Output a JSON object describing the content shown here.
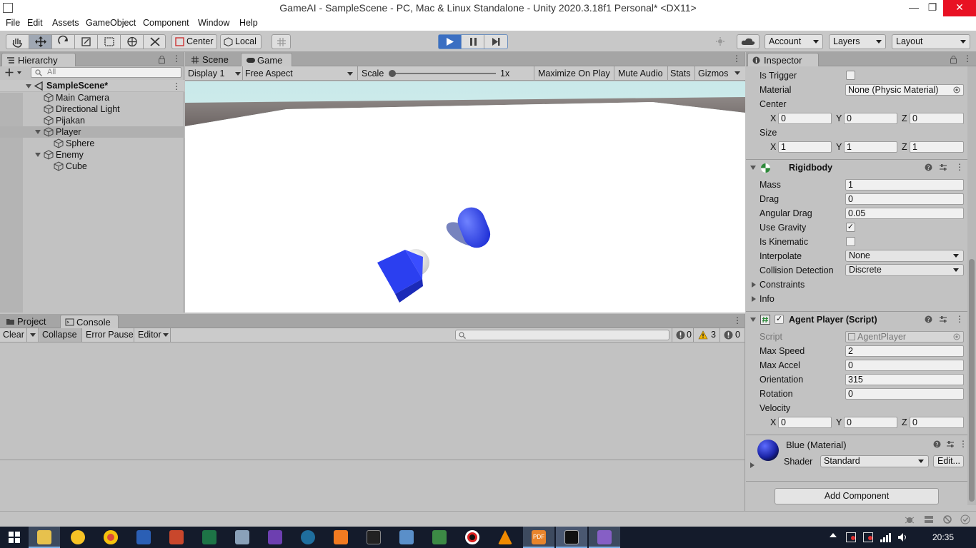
{
  "window": {
    "title": "GameAI - SampleScene - PC, Mac & Linux Standalone - Unity 2020.3.18f1 Personal* <DX11>",
    "minimize": "—",
    "restore": "❐",
    "close": "✕"
  },
  "menu": [
    "File",
    "Edit",
    "Assets",
    "GameObject",
    "Component",
    "Window",
    "Help"
  ],
  "toolbar": {
    "pivot_label": "Center",
    "space_label": "Local",
    "account_label": "Account",
    "layers_label": "Layers",
    "layout_label": "Layout",
    "play_color": "#3b6fc2"
  },
  "hierarchy": {
    "tab": "Hierarchy",
    "search_placeholder": "All",
    "scene": "SampleScene*",
    "items": [
      {
        "label": "Main Camera"
      },
      {
        "label": "Directional Light"
      },
      {
        "label": "Pijakan"
      },
      {
        "label": "Player"
      },
      {
        "label": "Sphere"
      },
      {
        "label": "Enemy"
      },
      {
        "label": "Cube"
      }
    ]
  },
  "game": {
    "tabs": [
      "Scene",
      "Game"
    ],
    "display": "Display 1",
    "aspect": "Free Aspect",
    "scale_label": "Scale",
    "scale_value": "1x",
    "scale_fraction": 0.0,
    "buttons": [
      "Maximize On Play",
      "Mute Audio",
      "Stats",
      "Gizmos"
    ],
    "object_color": "#2b3ff0"
  },
  "console": {
    "tabs": [
      "Project",
      "Console"
    ],
    "clear": "Clear",
    "collapse": "Collapse",
    "error_pause": "Error Pause",
    "editor": "Editor",
    "log_count": "0",
    "warning_count": "3",
    "error_count": "0"
  },
  "inspector": {
    "tab": "Inspector",
    "collider": {
      "is_trigger_label": "Is Trigger",
      "is_trigger": false,
      "material_label": "Material",
      "material_value": "None (Physic Material)",
      "center_label": "Center",
      "center": {
        "x": "0",
        "y": "0",
        "z": "0"
      },
      "size_label": "Size",
      "size": {
        "x": "1",
        "y": "1",
        "z": "1"
      }
    },
    "rigidbody": {
      "title": "Rigidbody",
      "mass_label": "Mass",
      "mass": "1",
      "drag_label": "Drag",
      "drag": "0",
      "angular_drag_label": "Angular Drag",
      "angular_drag": "0.05",
      "use_gravity_label": "Use Gravity",
      "use_gravity": true,
      "is_kinematic_label": "Is Kinematic",
      "is_kinematic": false,
      "interpolate_label": "Interpolate",
      "interpolate": "None",
      "collision_label": "Collision Detection",
      "collision": "Discrete",
      "constraints_label": "Constraints",
      "info_label": "Info"
    },
    "agent": {
      "title": "Agent Player (Script)",
      "enabled": true,
      "script_label": "Script",
      "script": "AgentPlayer",
      "max_speed_label": "Max Speed",
      "max_speed": "2",
      "max_accel_label": "Max Accel",
      "max_accel": "0",
      "orientation_label": "Orientation",
      "orientation": "315",
      "rotation_label": "Rotation",
      "rotation": "0",
      "velocity_label": "Velocity",
      "velocity": {
        "x": "0",
        "y": "0",
        "z": "0"
      }
    },
    "material": {
      "title": "Blue (Material)",
      "shader_label": "Shader",
      "shader": "Standard",
      "edit": "Edit..."
    },
    "add_component": "Add Component",
    "axis": {
      "x": "X",
      "y": "Y",
      "z": "Z"
    }
  },
  "taskbar": {
    "time": "20:35",
    "pdf_label": "PDF"
  }
}
